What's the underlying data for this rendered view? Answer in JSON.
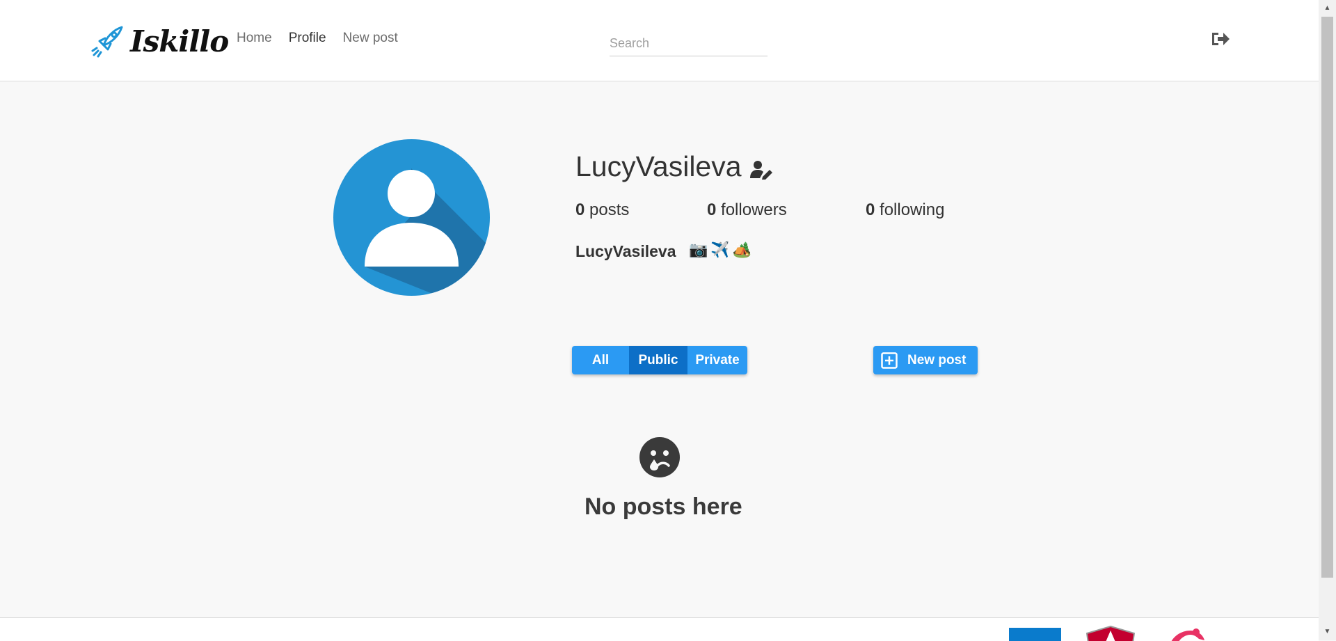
{
  "navbar": {
    "brand": "Iskillo",
    "links": [
      {
        "label": "Home",
        "active": false
      },
      {
        "label": "Profile",
        "active": true
      },
      {
        "label": "New post",
        "active": false
      }
    ],
    "search_placeholder": "Search",
    "logout_icon": "sign-out-icon"
  },
  "profile": {
    "username": "LucyVasileva",
    "edit_icon": "user-edit-icon",
    "stats": {
      "posts_count": "0",
      "posts_label": "posts",
      "followers_count": "0",
      "followers_label": "followers",
      "following_count": "0",
      "following_label": "following"
    },
    "bio_name": "LucyVasileva",
    "bio_emojis": "📷✈️🏕️"
  },
  "filters": {
    "all": "All",
    "public": "Public",
    "private": "Private",
    "selected": "Public"
  },
  "new_post_button": "New post",
  "empty_state": {
    "icon": "sad-tear-icon",
    "message": "No posts here"
  },
  "colors": {
    "accent": "#2b9af3",
    "accent_active": "#0d6fc7",
    "avatar_bg": "#2494d4",
    "text": "#333333",
    "page_bg": "#f8f8f8"
  }
}
